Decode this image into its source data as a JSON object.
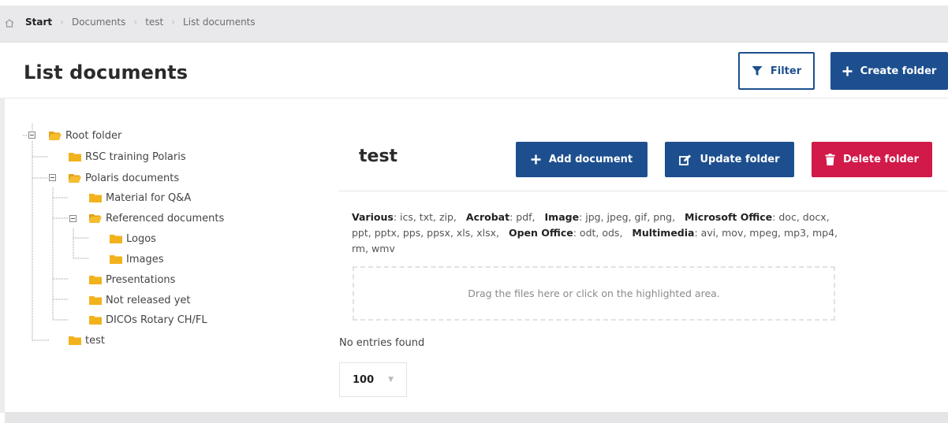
{
  "breadcrumb": {
    "items": [
      "Start",
      "Documents",
      "test",
      "List documents"
    ]
  },
  "header": {
    "title": "List documents",
    "filter_label": "Filter",
    "create_folder_label": "Create folder"
  },
  "tree": {
    "nodes": [
      {
        "label": "Root folder"
      },
      {
        "label": "RSC training Polaris"
      },
      {
        "label": "Polaris documents"
      },
      {
        "label": "Material for Q&A"
      },
      {
        "label": "Referenced documents"
      },
      {
        "label": "Logos"
      },
      {
        "label": "Images"
      },
      {
        "label": "Presentations"
      },
      {
        "label": "Not released yet"
      },
      {
        "label": "DICOs Rotary CH/FL"
      },
      {
        "label": "test"
      }
    ]
  },
  "folder": {
    "title": "test",
    "add_document_label": "Add document",
    "update_folder_label": "Update folder",
    "delete_folder_label": "Delete folder"
  },
  "file_types": [
    {
      "group": "Various",
      "exts": "ics, txt, zip,"
    },
    {
      "group": "Acrobat",
      "exts": "pdf,"
    },
    {
      "group": "Image",
      "exts": "jpg, jpeg, gif, png,"
    },
    {
      "group": "Microsoft Office",
      "exts": "doc, docx, ppt, pptx, pps, ppsx, xls, xlsx,"
    },
    {
      "group": "Open Office",
      "exts": "odt, ods,"
    },
    {
      "group": "Multimedia",
      "exts": "avi, mov, mpeg, mp3, mp4, rm, wmv"
    }
  ],
  "dropzone_text": "Drag the files here or click on the highlighted area.",
  "no_entries_text": "No entries found",
  "page_size": "100",
  "colors": {
    "primary": "#1d4f8f",
    "danger": "#d11a49",
    "folder": "#f2b21c"
  },
  "icons": {
    "home": "home-icon",
    "filter": "funnel-icon",
    "plus": "plus-icon",
    "edit": "edit-icon",
    "trash": "trash-icon",
    "folder": "folder-icon"
  }
}
